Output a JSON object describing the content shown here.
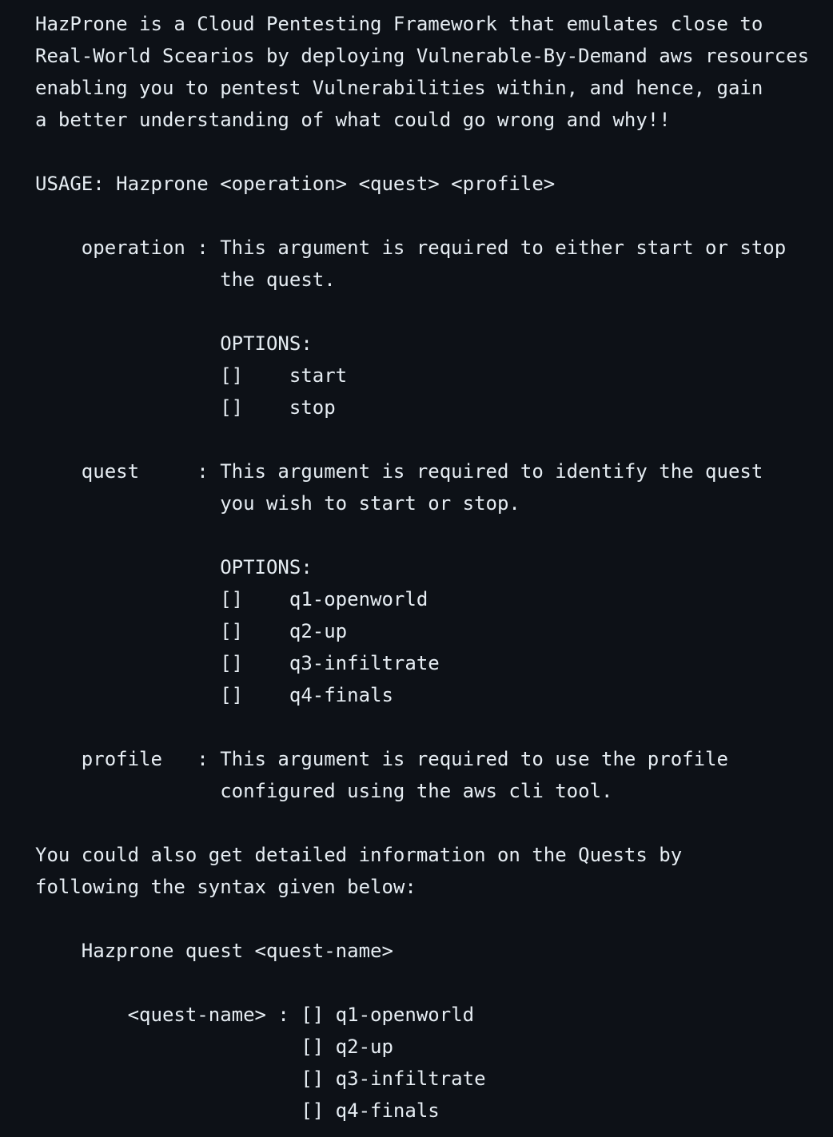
{
  "lines": [
    "HazProne is a Cloud Pentesting Framework that emulates close to",
    "Real-World Scearios by deploying Vulnerable-By-Demand aws resources",
    "enabling you to pentest Vulnerabilities within, and hence, gain",
    "a better understanding of what could go wrong and why!!",
    "USAGE: Hazprone <operation> <quest> <profile>",
    "    operation : This argument is required to either start or stop",
    "                the quest.",
    "                OPTIONS:",
    "                []    start",
    "                []    stop",
    "    quest     : This argument is required to identify the quest",
    "                you wish to start or stop.",
    "                OPTIONS:",
    "                []    q1-openworld",
    "                []    q2-up",
    "                []    q3-infiltrate",
    "                []    q4-finals",
    "    profile   : This argument is required to use the profile",
    "                configured using the aws cli tool.",
    "You could also get detailed information on the Quests by",
    "following the syntax given below:",
    "    Hazprone quest <quest-name>",
    "        <quest-name> : [] q1-openworld",
    "                       [] q2-up",
    "                       [] q3-infiltrate",
    "                       [] q4-finals"
  ]
}
